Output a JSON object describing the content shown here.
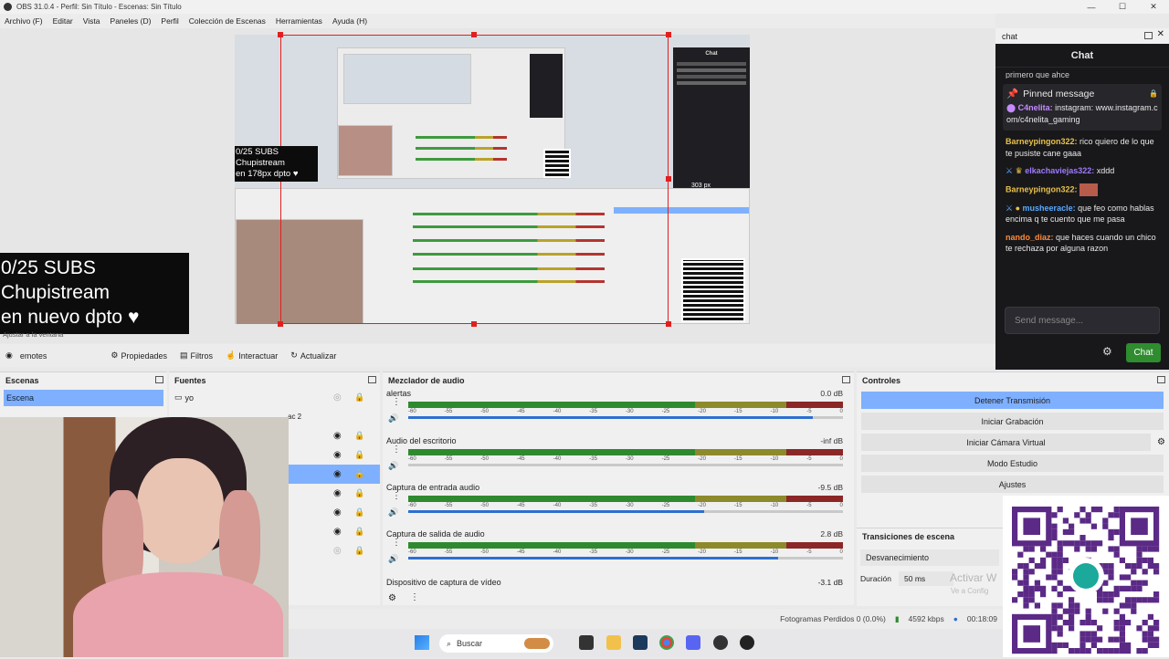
{
  "window": {
    "title": "OBS 31.0.4 - Perfil: Sin Título - Escenas: Sin Título",
    "min": "—",
    "max": "☐",
    "close": "✕"
  },
  "menu": [
    "Archivo (F)",
    "Editar",
    "Vista",
    "Paneles (D)",
    "Perfil",
    "Colección de Escenas",
    "Herramientas",
    "Ayuda (H)"
  ],
  "overlay": {
    "line1": "0/25 SUBS",
    "line2": "Chupistream",
    "line3": "en nuevo dpto ♥",
    "small_line3": "en 178px dpto ♥"
  },
  "preview": {
    "size_label": "303 px",
    "zoom_note": "Ajustar a la ventana"
  },
  "chat": {
    "dock_title": "chat",
    "header": "Chat",
    "top_fragment": "primero que ahce",
    "pinned_title": "Pinned message",
    "pinned_user": "C4nelita:",
    "pinned_text": "instagram: www.instagram.com/c4nelita_gaming",
    "messages": [
      {
        "user": "Barneypingon322:",
        "text": "rico quiero de lo que te pusiste cane gaaa",
        "color": "#e8c14a"
      },
      {
        "user": "elkachaviejas322:",
        "text": "xddd",
        "color": "#9f7aff"
      },
      {
        "user": "Barneypingon322:",
        "text": "",
        "color": "#e8c14a"
      },
      {
        "user": "musheeracle:",
        "text": "que feo como hablas encima q te cuento que me pasa",
        "color": "#5aa9ff"
      },
      {
        "user": "nando_diaz:",
        "text": "que haces cuando un chico te rechaza por alguna razon",
        "color": "#ff8a3a"
      }
    ],
    "input_placeholder": "Send message...",
    "send_label": "Chat"
  },
  "source_toolbar": {
    "current": "emotes",
    "properties": "Propiedades",
    "filters": "Filtros",
    "interact": "Interactuar",
    "refresh": "Actualizar"
  },
  "scenes": {
    "title": "Escenas",
    "items": [
      "Escena"
    ]
  },
  "sources": {
    "title": "Fuentes",
    "items": [
      "yo",
      "",
      "",
      "",
      "",
      "",
      "",
      "",
      ""
    ],
    "partial_label": "ac 2"
  },
  "mixer": {
    "title": "Mezclador de audio",
    "channels": [
      {
        "name": "alertas",
        "db": "0.0 dB",
        "level": 0.93
      },
      {
        "name": "Audio del escritorio",
        "db": "-inf dB",
        "level": 0.0
      },
      {
        "name": "Captura de entrada audio",
        "db": "-9.5 dB",
        "level": 0.68
      },
      {
        "name": "Captura de salida de audio",
        "db": "2.8 dB",
        "level": 0.85
      }
    ],
    "next_channel": "Dispositivo de captura de vídeo",
    "next_db": "-3.1 dB",
    "ticks": [
      "-60",
      "-55",
      "-50",
      "-45",
      "-40",
      "-35",
      "-30",
      "-25",
      "-20",
      "-15",
      "-10",
      "-5",
      "0"
    ]
  },
  "controls": {
    "title": "Controles",
    "stop_stream": "Detener Transmisión",
    "start_recording": "Iniciar Grabación",
    "virtual_cam": "Iniciar Cámara Virtual",
    "studio_mode": "Modo Estudio",
    "settings": "Ajustes"
  },
  "transitions": {
    "title": "Transiciones de escena",
    "type": "Desvanecimiento",
    "duration_label": "Duración",
    "duration_value": "50 ms"
  },
  "watermark": {
    "line1": "Activar W",
    "line2": "Ve a Config"
  },
  "status": {
    "dropped": "Fotogramas Perdidos 0 (0.0%)",
    "kbps": "4592 kbps",
    "time": "00:18:09"
  },
  "taskbar": {
    "search": "Buscar"
  },
  "colors": {
    "accent": "#7fb0ff",
    "selection": "#e02020",
    "chat_bg": "#18181b",
    "send": "#2f8c2f",
    "qr": "#5b2a86"
  }
}
